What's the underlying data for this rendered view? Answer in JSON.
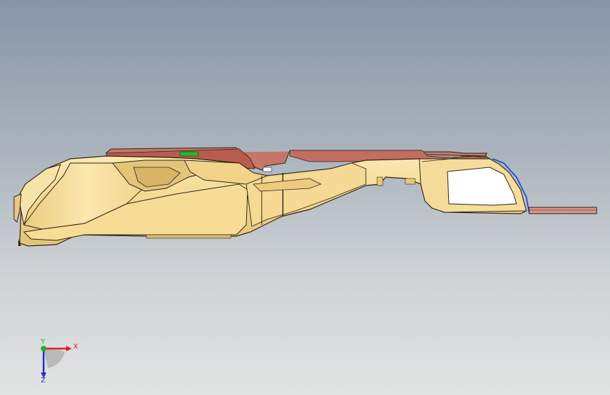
{
  "viewport": {
    "background_top": "#8995a6",
    "background_bottom": "#e2e3e3"
  },
  "model": {
    "body_color": "#f6dc98",
    "body_shadow": "#d9b866",
    "top_trim_color": "#b85c4e",
    "edge_color": "#2a2418",
    "marker_color": "#2fb52f",
    "flange_color": "#d9968c",
    "inner_highlight": "#ffffff",
    "blue_edge": "#1f4fd0"
  },
  "triad": {
    "x_label": "X",
    "y_label": "Y",
    "z_label": "Z",
    "x_color": "#e02020",
    "y_color": "#20b020",
    "z_color": "#2030d0"
  }
}
